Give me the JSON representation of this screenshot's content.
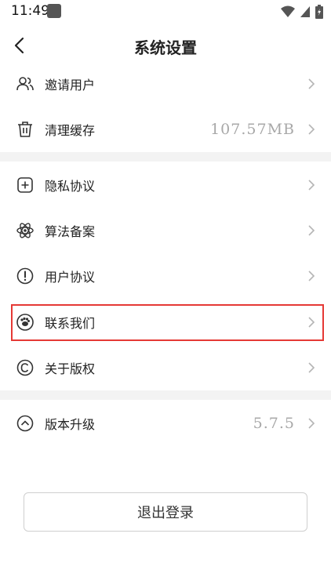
{
  "status_bar": {
    "time": "11:49",
    "icons": [
      "notification-app-icon",
      "wifi-icon",
      "cellular-icon",
      "battery-icon"
    ]
  },
  "header": {
    "title": "系统设置",
    "back_icon": "back-arrow-icon"
  },
  "settings": {
    "group1": [
      {
        "label": "邀请用户",
        "icon": "users-icon",
        "value": ""
      },
      {
        "label": "清理缓存",
        "icon": "trash-icon",
        "value": "107.57MB"
      }
    ],
    "group2": [
      {
        "label": "隐私协议",
        "icon": "plus-square-icon",
        "value": ""
      },
      {
        "label": "算法备案",
        "icon": "atom-icon",
        "value": ""
      },
      {
        "label": "用户协议",
        "icon": "exclamation-circle-icon",
        "value": ""
      },
      {
        "label": "联系我们",
        "icon": "paw-icon",
        "value": ""
      },
      {
        "label": "关于版权",
        "icon": "copyright-icon",
        "value": ""
      }
    ],
    "group3": [
      {
        "label": "版本升级",
        "icon": "chevron-up-circle-icon",
        "value": "5.7.5"
      }
    ]
  },
  "logout_label": "退出登录",
  "colors": {
    "highlight_border": "#e53935",
    "value_text": "#a8a8a8",
    "separator": "#f3f3f3"
  }
}
